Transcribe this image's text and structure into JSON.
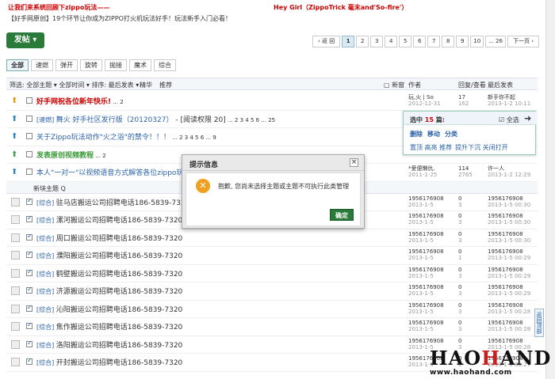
{
  "top_links": {
    "link1": "让我们来系统回顾下zippo玩法——",
    "link2": "Hey Girl（ZippoTrick 毫末and'So-fire'）",
    "link3": "【好手网原创】19个环节让你成为ZIPPO打火机玩法好手！玩法新手入门必看！"
  },
  "post_button": "发帖",
  "pager": {
    "prev": "‹ 返 回",
    "pages": [
      "1",
      "2",
      "3",
      "4",
      "5",
      "6",
      "7",
      "8",
      "9",
      "10",
      "... 26"
    ],
    "current": "1",
    "next": "下一页 ›"
  },
  "tabs": [
    "全部",
    "速燃",
    "弹开",
    "旋转",
    "抛接",
    "魔术",
    "综合"
  ],
  "filter": {
    "label": "筛选: 全部主题 ▾  全部时间 ▾  排序: 最后发表 ▾",
    "hot": "精华",
    "recommend": "推荐",
    "newwin": "新窗",
    "col_author": "作者",
    "col_reply": "回复/查看",
    "col_last": "最后发表"
  },
  "pinned": [
    {
      "icon": "orange",
      "title": "好手网祝各位新年快乐!",
      "pages": "... 2",
      "author": "玩,火 | So",
      "date": "2012-12-31",
      "replies": "17",
      "views": "162",
      "last_user": "新手你不起",
      "last_date": "2013-1-2 10:11"
    },
    {
      "icon": "blue",
      "tag": "[速燃]",
      "title": "舞火 好手社区发行版（20120327）",
      "suffix": " - [阅读权限 20]",
      "pages": "... 2 3 4 5 6 ... 25",
      "author": "",
      "date": "",
      "replies": "",
      "views": "",
      "last_user": "",
      "last_date": ""
    },
    {
      "icon": "blue",
      "title": "关于Zippo玩法动作\"火之浴\"的禁令！！！",
      "pages": "... 2 3 4 5 6 ... 9",
      "author": "",
      "date": "",
      "replies": "",
      "views": "",
      "last_user": "",
      "last_date": ""
    },
    {
      "icon": "green",
      "title": "发表原创视频教程",
      "pages": "... 2",
      "author": "",
      "date": "",
      "replies": "",
      "views": "",
      "last_user": "",
      "last_date": ""
    },
    {
      "icon": "blue",
      "title": "本人\"一对一\"以视频语音方式解答各位zippo玩法爱好",
      "pages": "",
      "author": "*爱便懒仇.",
      "date": "2011-1-25",
      "replies": "114",
      "views": "2765",
      "last_user": "许一人",
      "last_date": "2013-1-2 12:29"
    }
  ],
  "new_label": "新块主题 Q",
  "threads": [
    {
      "title": "驻马店搬运公司招聘电话186-5839-7320",
      "author": "1956176908",
      "date": "2013-1-5",
      "replies": "0",
      "views": "3",
      "last_user": "1956176908",
      "last_date": "2013-1-5 00:30"
    },
    {
      "title": "漯河搬运公司招聘电话186-5839-7320",
      "author": "1956176908",
      "date": "2013-1-5",
      "replies": "0",
      "views": "3",
      "last_user": "1956176908",
      "last_date": "2013-1-5 00:30"
    },
    {
      "title": "周口搬运公司招聘电话186-5839-7320",
      "author": "1956176908",
      "date": "2013-1-5",
      "replies": "0",
      "views": "3",
      "last_user": "1956176908",
      "last_date": "2013-1-5 00:30"
    },
    {
      "title": "濮阳搬运公司招聘电话186-5839-7320",
      "author": "1956176908",
      "date": "2013-1-5",
      "replies": "0",
      "views": "1",
      "last_user": "1956176908",
      "last_date": "2013-1-5 00:29"
    },
    {
      "title": "鹤壁搬运公司招聘电话186-5839-7320",
      "author": "1956176908",
      "date": "2013-1-5",
      "replies": "0",
      "views": "3",
      "last_user": "1956176908",
      "last_date": "2013-1-5 00:29"
    },
    {
      "title": "济源搬运公司招聘电话186-5839-7320",
      "author": "1956176908",
      "date": "2013-1-5",
      "replies": "0",
      "views": "3",
      "last_user": "1956176908",
      "last_date": "2013-1-5 00:29"
    },
    {
      "title": "沁阳搬运公司招聘电话186-5839-7320",
      "author": "1956176908",
      "date": "2013-1-5",
      "replies": "0",
      "views": "3",
      "last_user": "1956176908",
      "last_date": "2013-1-5 00:28"
    },
    {
      "title": "焦作搬运公司招聘电话186-5839-7320",
      "author": "1956176908",
      "date": "2013-1-5",
      "replies": "0",
      "views": "3",
      "last_user": "1956176908",
      "last_date": "2013-1-5 00:28"
    },
    {
      "title": "洛阳搬运公司招聘电话186-5839-7320",
      "author": "1956176908",
      "date": "2013-1-5",
      "replies": "0",
      "views": "3",
      "last_user": "1956176908",
      "last_date": "2013-1-5 00:28"
    },
    {
      "title": "开封搬运公司招聘电话186-5839-7320",
      "author": "1956176908",
      "date": "2013-1-5",
      "replies": "0",
      "views": "3",
      "last_user": "1956176908",
      "last_date": "2013-1-5 00:27"
    }
  ],
  "thread_tag": "[综合]",
  "popup": {
    "selected_prefix": "选中 ",
    "selected_count": "15",
    "selected_suffix": " 篇:",
    "select_all": "全选",
    "actions1": [
      "删除",
      "移动",
      "分类"
    ],
    "actions2": [
      "置顶 高亮 推荐",
      "提升下沉 关闭打开"
    ]
  },
  "dialog": {
    "title": "提示信息",
    "message": "抱歉, 您尚未选择主题或主题不可执行此类管理",
    "ok": "确定"
  },
  "side_button": "返回顶部",
  "watermark": {
    "logo_prefix": "HAO",
    "logo_h": "H",
    "logo_suffix": "AND",
    "url": "www.haohand.com"
  }
}
